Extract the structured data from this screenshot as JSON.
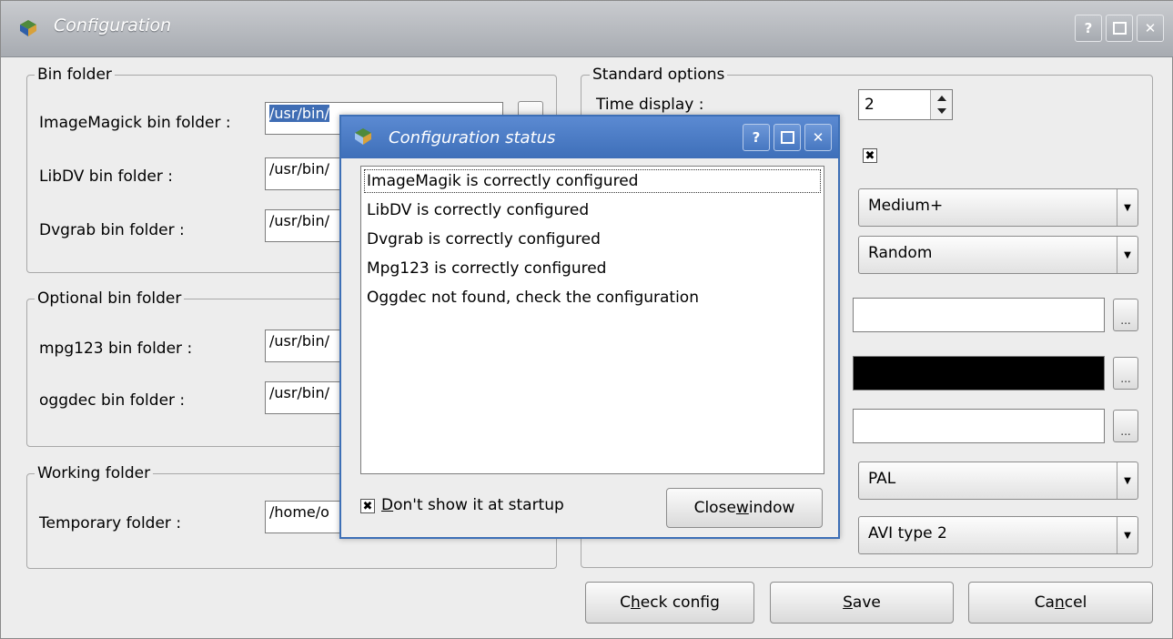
{
  "window": {
    "title": "Configuration",
    "help": "?",
    "close": "✕"
  },
  "bin_folder": {
    "title": "Bin folder",
    "imagemagick": {
      "label": "ImageMagick bin folder :",
      "value": "/usr/bin/"
    },
    "libdv": {
      "label": "LibDV bin folder :",
      "value": "/usr/bin/"
    },
    "dvgrab": {
      "label": "Dvgrab bin folder :",
      "value": "/usr/bin/"
    }
  },
  "optional_bin_folder": {
    "title": "Optional bin folder",
    "mpg123": {
      "label": "mpg123 bin folder :",
      "value": "/usr/bin/"
    },
    "oggdec": {
      "label": "oggdec bin folder :",
      "value": "/usr/bin/"
    }
  },
  "working_folder": {
    "title": "Working folder",
    "temporary": {
      "label": "Temporary folder :",
      "value": "/home/o"
    }
  },
  "standard_options": {
    "title": "Standard options",
    "time_display": {
      "label": "Time display :",
      "value": "2"
    },
    "checkbox_mark": "✖",
    "combo1": "Medium+",
    "combo2": "Random",
    "color_field_color": "#000000",
    "combo3": "PAL",
    "combo4": "AVI type 2",
    "browse": "..."
  },
  "buttons": {
    "check_config": {
      "pre": "C",
      "u": "h",
      "post": "eck config"
    },
    "save": {
      "pre": "",
      "u": "S",
      "post": "ave"
    },
    "cancel": {
      "pre": "Ca",
      "u": "n",
      "post": "cel"
    }
  },
  "dialog": {
    "title": "Configuration status",
    "help": "?",
    "close": "✕",
    "messages": [
      "ImageMagik is correctly configured",
      "LibDV is correctly configured",
      "Dvgrab is correctly configured",
      "Mpg123 is correctly configured",
      "Oggdec not found, check the configuration"
    ],
    "dont_show": {
      "u": "D",
      "post": "on't show it at startup",
      "mark": "✖"
    },
    "close_button": {
      "pre": "Close ",
      "u": "w",
      "post": "indow"
    }
  }
}
